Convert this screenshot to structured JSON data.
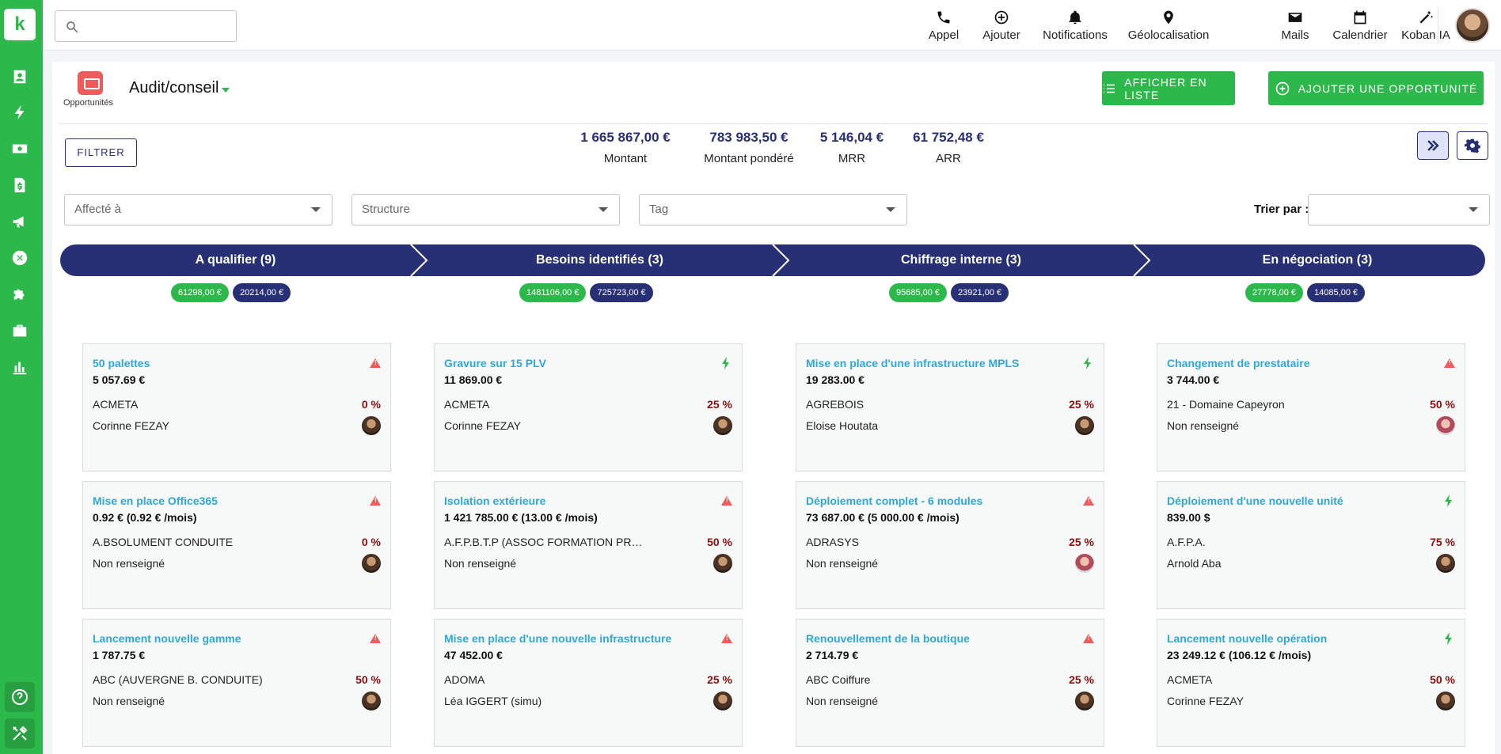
{
  "app": {
    "logo_letter": "k",
    "accent": "#2db84b",
    "navy": "#273074"
  },
  "search": {
    "placeholder": ""
  },
  "topbar": {
    "items": [
      {
        "label": "Appel",
        "icon": "phone-icon"
      },
      {
        "label": "Ajouter",
        "icon": "plus-circle-icon"
      },
      {
        "label": "Notifications",
        "icon": "bell-icon"
      },
      {
        "label": "Géolocalisation",
        "icon": "map-pin-icon"
      },
      {
        "label": "Mails",
        "icon": "mail-icon"
      },
      {
        "label": "Calendrier",
        "icon": "calendar-icon"
      },
      {
        "label": "Koban IA",
        "icon": "magic-wand-icon"
      }
    ]
  },
  "sidebar": {
    "icons": [
      "contacts-icon",
      "bolt-icon",
      "money-icon",
      "invoice-icon",
      "megaphone-icon",
      "wrench-icon",
      "puzzle-icon",
      "briefcase-icon",
      "chart-bar-icon"
    ],
    "bottom": [
      "help-icon",
      "tools-icon"
    ]
  },
  "header": {
    "module_label": "Opportunités",
    "title": "Audit/conseil",
    "list_button": "AFFICHER EN LISTE",
    "add_button": "AJOUTER UNE OPPORTUNITÉ"
  },
  "filter_button": "FILTRER",
  "stats": [
    {
      "value": "1 665 867,00 €",
      "label": "Montant"
    },
    {
      "value": "783 983,50 €",
      "label": "Montant pondéré"
    },
    {
      "value": "5 146,04 €",
      "label": "MRR"
    },
    {
      "value": "61 752,48 €",
      "label": "ARR"
    }
  ],
  "selects": {
    "assigned": "Affecté à",
    "structure": "Structure",
    "tag": "Tag",
    "sort_label": "Trier par :",
    "sort_value": ""
  },
  "stages": [
    {
      "label": "A qualifier (9)",
      "amount": "61298,00 €",
      "weighted": "20214,00 €"
    },
    {
      "label": "Besoins identifiés (3)",
      "amount": "1481106,00 €",
      "weighted": "725723,00 €"
    },
    {
      "label": "Chiffrage interne (3)",
      "amount": "95685,00 €",
      "weighted": "23921,00 €"
    },
    {
      "label": "En négociation (3)",
      "amount": "27778,00 €",
      "weighted": "14085,00 €"
    }
  ],
  "cards": [
    [
      {
        "title": "50 palettes",
        "amount": "5 057.69 €",
        "company": "ACMETA",
        "pct": "0 %",
        "person": "Corinne FEZAY",
        "flag": "warning",
        "avatar": "male"
      },
      {
        "title": "Mise en place Office365",
        "amount": "0.92 € (0.92 € /mois)",
        "company": "A.BSOLUMENT CONDUITE",
        "pct": "0 %",
        "person": "Non renseigné",
        "flag": "warning",
        "avatar": "male"
      },
      {
        "title": "Lancement nouvelle gamme",
        "amount": "1 787.75 €",
        "company": "ABC (AUVERGNE B. CONDUITE)",
        "pct": "50 %",
        "person": "Non renseigné",
        "flag": "warning",
        "avatar": "male"
      }
    ],
    [
      {
        "title": "Gravure sur 15 PLV",
        "amount": "11 869.00 €",
        "company": "ACMETA",
        "pct": "25 %",
        "person": "Corinne FEZAY",
        "flag": "bolt",
        "avatar": "male"
      },
      {
        "title": "Isolation extérieure",
        "amount": "1 421 785.00 € (13.00 € /mois)",
        "company": "A.F.P.B.T.P (ASSOC FORMATION PR…",
        "pct": "50 %",
        "person": "Non renseigné",
        "flag": "warning",
        "avatar": "male"
      },
      {
        "title": "Mise en place d'une nouvelle infrastructure",
        "amount": "47 452.00 €",
        "company": "ADOMA",
        "pct": "25 %",
        "person": "Léa IGGERT (simu)",
        "flag": "warning",
        "avatar": "male"
      }
    ],
    [
      {
        "title": "Mise en place d'une infrastructure MPLS",
        "amount": "19 283.00 €",
        "company": "AGREBOIS",
        "pct": "25 %",
        "person": "Eloise Houtata",
        "flag": "bolt",
        "avatar": "male"
      },
      {
        "title": "Déploiement complet - 6 modules",
        "amount": "73 687.00 € (5 000.00 € /mois)",
        "company": "ADRASYS",
        "pct": "25 %",
        "person": "Non renseigné",
        "flag": "warning",
        "avatar": "female"
      },
      {
        "title": "Renouvellement de la boutique",
        "amount": "2 714.79 €",
        "company": "ABC Coiffure",
        "pct": "25 %",
        "person": "Non renseigné",
        "flag": "warning",
        "avatar": "male"
      }
    ],
    [
      {
        "title": "Changement de prestataire",
        "amount": "3 744.00 €",
        "company": "21 - Domaine Capeyron",
        "pct": "50 %",
        "person": "Non renseigné",
        "flag": "warning",
        "avatar": "female"
      },
      {
        "title": "Déploiement d'une nouvelle unité",
        "amount": "839.00 $",
        "company": "A.F.P.A.",
        "pct": "75 %",
        "person": "Arnold Aba",
        "flag": "bolt",
        "avatar": "male"
      },
      {
        "title": "Lancement nouvelle opération",
        "amount": "23 249.12 € (106.12 € /mois)",
        "company": "ACMETA",
        "pct": "50 %",
        "person": "Corinne FEZAY",
        "flag": "bolt",
        "avatar": "male"
      }
    ]
  ]
}
